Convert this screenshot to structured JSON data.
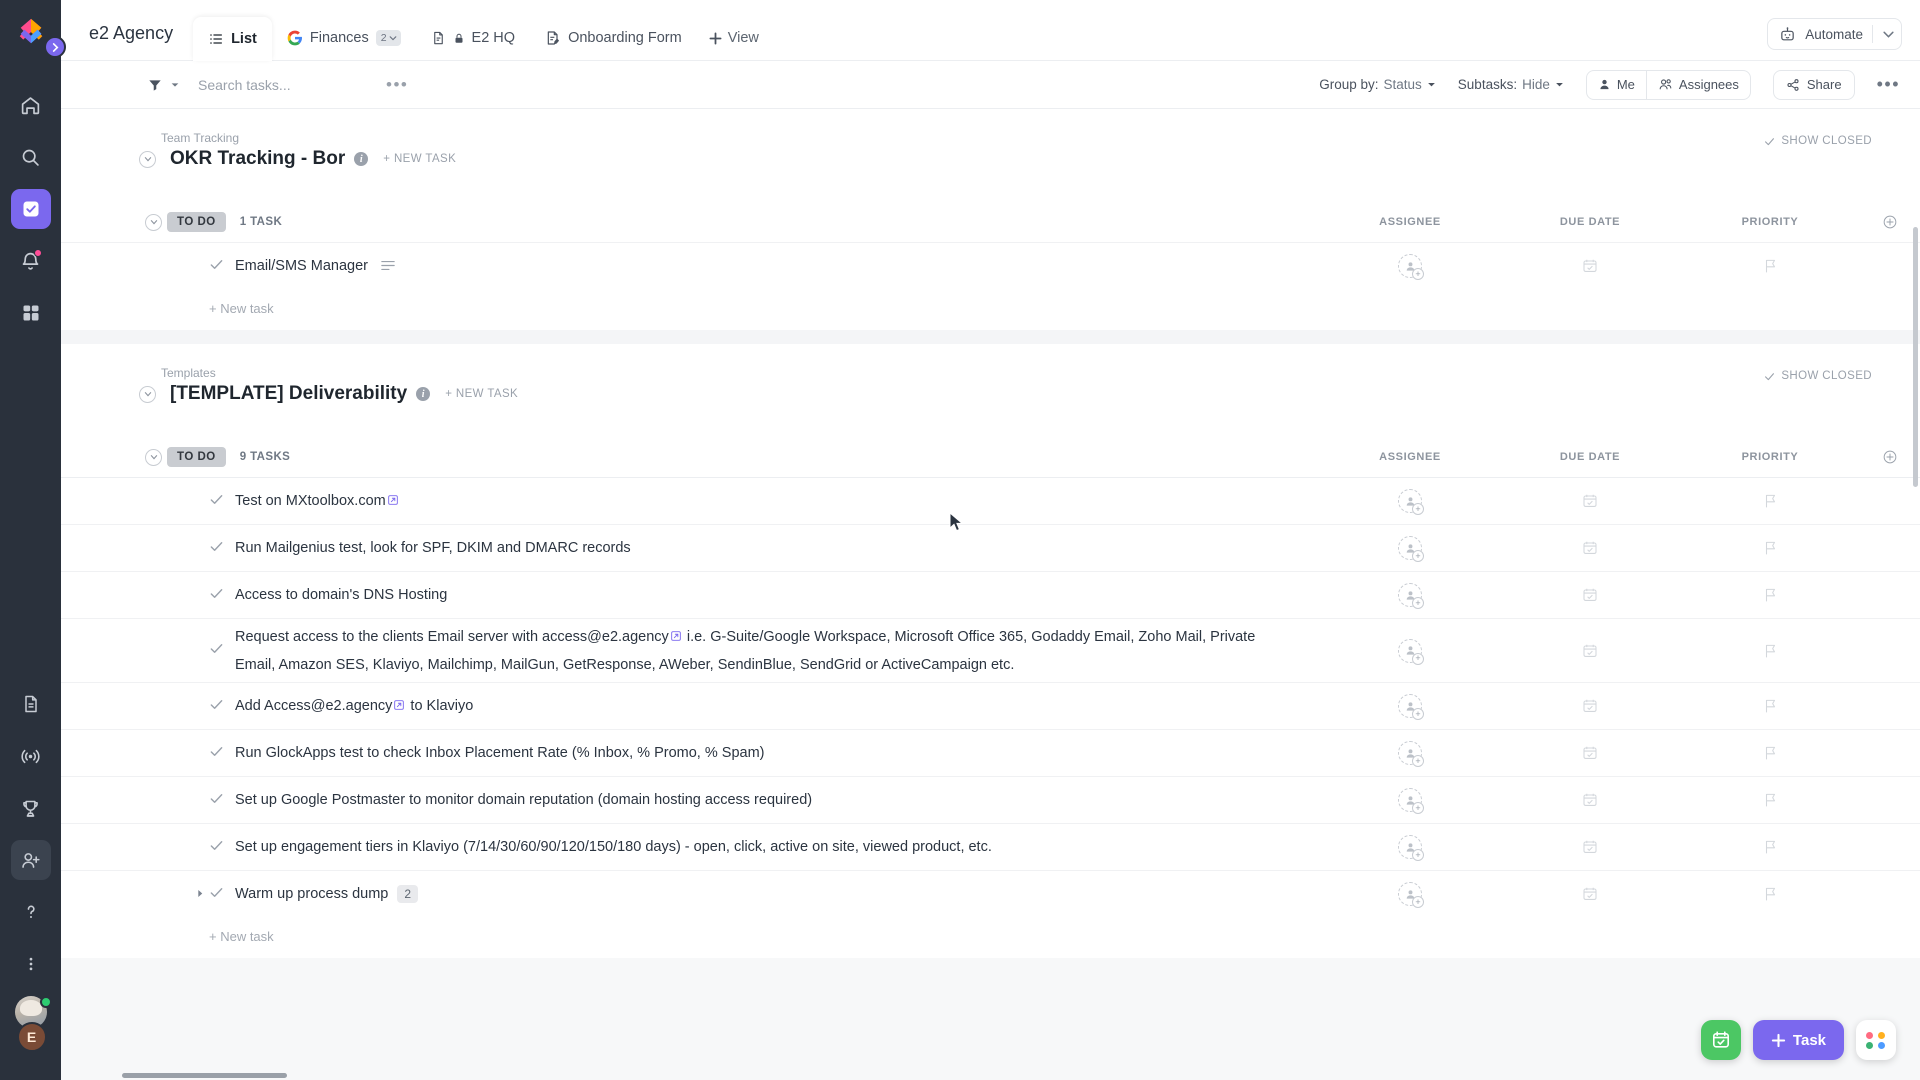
{
  "brand": {
    "accent": "#7b68ee",
    "rail_bg": "#2a313c",
    "green": "#4cc764"
  },
  "rail": {
    "expand_icon": "chevron-right",
    "items": [
      {
        "name": "home",
        "glyph": "home-icon",
        "active": false
      },
      {
        "name": "search",
        "glyph": "search-icon",
        "active": false
      },
      {
        "name": "tasks",
        "glyph": "checkbox-icon",
        "active": true
      },
      {
        "name": "notifications",
        "glyph": "bell-icon",
        "active": false,
        "badge": true
      },
      {
        "name": "dashboards",
        "glyph": "grid-icon",
        "active": false
      }
    ],
    "bottom_items": [
      {
        "name": "docs",
        "glyph": "document-icon"
      },
      {
        "name": "whiteboards",
        "glyph": "broadcast-icon"
      },
      {
        "name": "goals",
        "glyph": "trophy-icon"
      },
      {
        "name": "invite",
        "glyph": "add-user-icon",
        "active": true
      },
      {
        "name": "help",
        "glyph": "question-icon"
      },
      {
        "name": "more",
        "glyph": "more-vertical-icon"
      }
    ],
    "avatar_initial": "E"
  },
  "header": {
    "workspace_title": "e2 Agency",
    "tabs": [
      {
        "label": "List",
        "icon": "list-icon",
        "active": true
      },
      {
        "label": "Finances",
        "icon": "google-icon",
        "active": false,
        "badge": "2"
      },
      {
        "label": "E2 HQ",
        "icon": "doc-icon",
        "lock": true,
        "active": false
      },
      {
        "label": "Onboarding Form",
        "icon": "form-icon",
        "active": false
      }
    ],
    "add_view_label": "View",
    "automate_label": "Automate"
  },
  "toolbar": {
    "filter_icon": "filter-icon",
    "search_placeholder": "Search tasks...",
    "search_value": "",
    "overflow_icon": "ellipsis-icon",
    "group_by_label": "Group by:",
    "group_by_value": "Status",
    "subtasks_label": "Subtasks:",
    "subtasks_value": "Hide",
    "me_label": "Me",
    "assignees_label": "Assignees",
    "share_label": "Share",
    "more_icon": "ellipsis-icon"
  },
  "columns": {
    "assignee": "ASSIGNEE",
    "due_date": "DUE DATE",
    "priority": "PRIORITY",
    "add": "add-column-icon"
  },
  "labels": {
    "new_task": "+ NEW TASK",
    "show_closed": "SHOW CLOSED",
    "new_task_row": "+ New task"
  },
  "lists": [
    {
      "breadcrumb": "Team Tracking",
      "title": "OKR Tracking - Bor",
      "status": "TO DO",
      "task_count": "1 TASK",
      "tasks": [
        {
          "name": "Email/SMS Manager",
          "has_description": true,
          "links": [],
          "subtasks": null,
          "expandable": false
        }
      ]
    },
    {
      "breadcrumb": "Templates",
      "title": "[TEMPLATE] Deliverability",
      "status": "TO DO",
      "task_count": "9 TASKS",
      "tasks": [
        {
          "name": "Test on MXtoolbox.com",
          "link_after": true,
          "has_description": false,
          "subtasks": null,
          "expandable": false
        },
        {
          "name": "Run Mailgenius test, look for SPF, DKIM and DMARC records",
          "has_description": false,
          "subtasks": null,
          "expandable": false
        },
        {
          "name": "Access to domain's DNS Hosting",
          "has_description": false,
          "subtasks": null,
          "expandable": false
        },
        {
          "name_pre": "Request access to the clients Email server with access@e2.agency",
          "name_post": " i.e. G-Suite/Google Workspace, Microsoft Office 365, Godaddy Email, Zoho Mail, Private Email, Amazon SES, Klaviyo, Mailchimp, MailGun, GetResponse, AWeber, SendinBlue, SendGrid or ActiveCampaign etc.",
          "link_inline": true,
          "tall": true,
          "subtasks": null,
          "expandable": false
        },
        {
          "name_pre": "Add Access@e2.agency",
          "name_post": " to Klaviyo",
          "link_inline": true,
          "subtasks": null,
          "expandable": false
        },
        {
          "name": "Run GlockApps test to check Inbox Placement Rate (% Inbox, % Promo, % Spam)",
          "subtasks": null,
          "expandable": false
        },
        {
          "name": "Set up Google Postmaster to monitor domain reputation (domain hosting access required)",
          "subtasks": null,
          "expandable": false
        },
        {
          "name": "Set up engagement tiers in Klaviyo (7/14/30/60/90/120/150/180 days) - open, click, active on site, viewed product, etc.",
          "subtasks": null,
          "expandable": false
        },
        {
          "name": "Warm up process dump",
          "subtasks": "2",
          "expandable": true
        }
      ]
    }
  ],
  "fabs": {
    "calendar_icon": "calendar-icon",
    "task_label": "Task",
    "apps_icon": "apps-grid-icon"
  }
}
